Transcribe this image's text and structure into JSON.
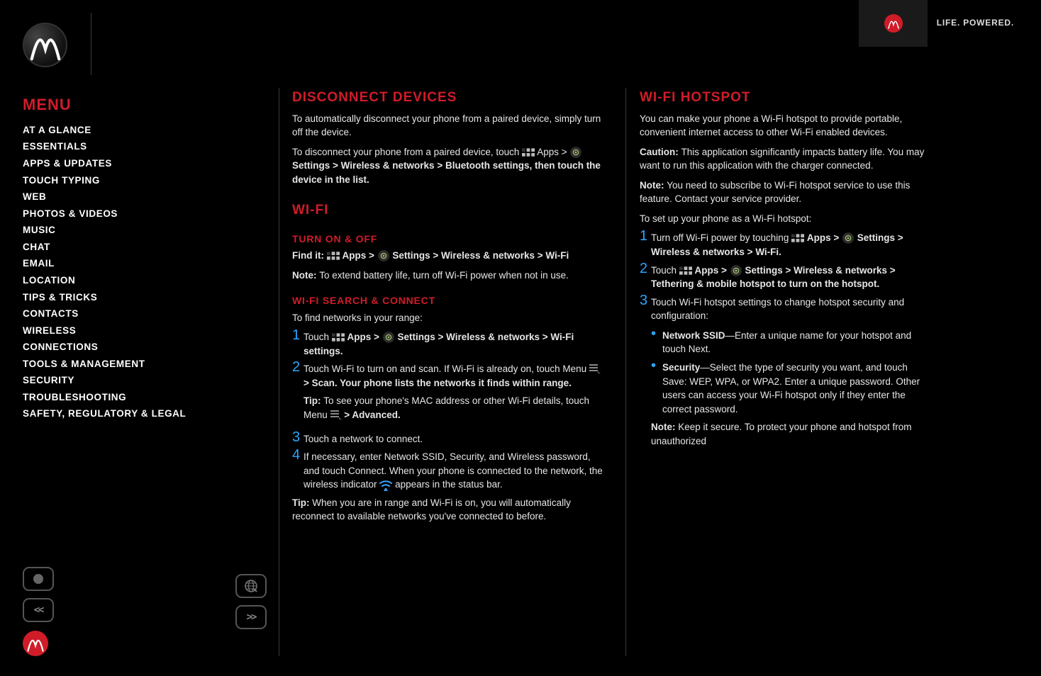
{
  "productTopRight": "LIFE. POWERED.",
  "sidebar": {
    "title": "MENU",
    "items": [
      "AT A GLANCE",
      "ESSENTIALS",
      "APPS & UPDATES",
      "TOUCH TYPING",
      "WEB",
      "PHOTOS & VIDEOS",
      "MUSIC",
      "CHAT",
      "EMAIL",
      "LOCATION",
      "TIPS & TRICKS",
      "CONTACTS",
      "WIRELESS",
      "CONNECTIONS",
      "TOOLS & MANAGEMENT",
      "SECURITY",
      "TROUBLESHOOTING",
      "SAFETY, REGULATORY & LEGAL"
    ]
  },
  "glyphs": {
    "chev_right": ">",
    "bullet": "•"
  },
  "nav": {
    "back_glyph": "<<",
    "fwd_glyph": ">>"
  },
  "left": {
    "h_disconnect": "DISCONNECT DEVICES",
    "disc_p1": "To automatically disconnect your phone from a paired device, simply turn off the device.",
    "disc_p2_a": "To disconnect your phone from a paired device, touch ",
    "disc_p2_b": " Apps > ",
    "disc_p2_c": " Settings > Wireless & networks > Bluetooth settings, then touch the device in the list.",
    "h_wifi": "WI-FI",
    "h_turn": "TURN ON & OFF",
    "turn_a": "Find it: ",
    "turn_b": " Apps > ",
    "turn_c": " Settings > Wireless & networks > Wi-Fi",
    "turn_note_lbl": "Note: ",
    "turn_note": "To extend battery life, turn off Wi-Fi power when not in use.",
    "h_search": "WI-FI SEARCH & CONNECT",
    "search_p1": "To find networks in your range:",
    "s1_a": "Touch ",
    "s1_b": " Apps > ",
    "s1_c": " Settings > Wireless & networks > Wi-Fi settings.",
    "s2_a": "Touch Wi-Fi to turn on and scan. If Wi-Fi is already on, touch Menu ",
    "s2_b": " > Scan. Your phone lists the networks it finds within range.",
    "s2_tip_lbl": "Tip: ",
    "s2_tip_a": "To see your phone's MAC address or other Wi-Fi details, touch Menu ",
    "s2_tip_b": " > Advanced.",
    "s3": "Touch a network to connect.",
    "s4": "If necessary, enter Network SSID, Security, and Wireless password, and touch Connect. When your phone is connected to the network, the wireless indicator ",
    "s4_b": " appears in the status bar.",
    "search_tip_lbl": "Tip: ",
    "search_tip": "When you are in range and Wi-Fi is on, you will automatically reconnect to available networks you've connected to before."
  },
  "right": {
    "h_hotspot": "WI-FI HOTSPOT",
    "p1": "You can make your phone a Wi-Fi hotspot to provide portable, convenient internet access to other Wi-Fi enabled devices.",
    "caution_lbl": "Caution: ",
    "caution": "This application significantly impacts battery life. You may want to run this application with the charger connected.",
    "note_lbl": "Note: ",
    "note": "You need to subscribe to Wi-Fi hotspot service to use this feature. Contact your service provider.",
    "setup_intro": "To set up your phone as a Wi-Fi hotspot:",
    "s1_a": "Turn off Wi-Fi power by touching ",
    "s1_b": " Apps > ",
    "s1_c": " Settings > Wireless & networks > Wi-Fi.",
    "s2_a": "Touch ",
    "s2_b": " Apps > ",
    "s2_c": " Settings > Wireless & networks > Tethering & mobile hotspot to turn on the hotspot.",
    "s3": "Touch Wi-Fi hotspot settings to change hotspot security and configuration:",
    "s3_b1_a": "Network SSID",
    "s3_b1_b": "—Enter a unique name for your hotspot and touch Next.",
    "s3_b2_a": "Security",
    "s3_b2_b": "—Select the type of security you want, and touch Save: WEP, WPA, or WPA2. Enter a unique password. Other users can access your Wi-Fi hotspot only if they enter the correct password.",
    "s3_note_lbl": "Note: ",
    "s3_note": "Keep it secure. To protect your phone and hotspot from unauthorized"
  }
}
